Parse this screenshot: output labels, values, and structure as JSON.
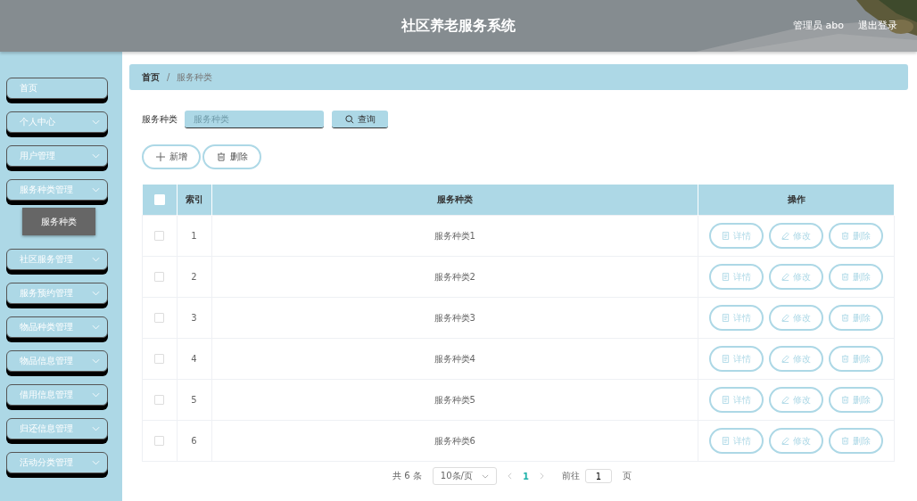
{
  "header": {
    "title": "社区养老服务系统",
    "user": "管理员 abo",
    "logout": "退出登录"
  },
  "sidebar": {
    "items": [
      {
        "label": "首页",
        "kind": "link"
      },
      {
        "label": "个人中心",
        "kind": "menu"
      },
      {
        "label": "用户管理",
        "kind": "menu"
      },
      {
        "label": "服务种类管理",
        "kind": "menu",
        "children": [
          {
            "label": "服务种类",
            "selected": true
          }
        ]
      },
      {
        "label": "社区服务管理",
        "kind": "menu"
      },
      {
        "label": "服务预约管理",
        "kind": "menu"
      },
      {
        "label": "物品种类管理",
        "kind": "menu"
      },
      {
        "label": "物品信息管理",
        "kind": "menu"
      },
      {
        "label": "借用信息管理",
        "kind": "menu"
      },
      {
        "label": "归还信息管理",
        "kind": "menu"
      },
      {
        "label": "活动分类管理",
        "kind": "menu"
      }
    ]
  },
  "breadcrumb": {
    "items": [
      "首页",
      "服务种类"
    ],
    "separator": "/"
  },
  "search": {
    "label": "服务种类",
    "placeholder": "服务种类",
    "button": "查询"
  },
  "actions": [
    "新增",
    "删除"
  ],
  "table": {
    "columns": [
      "索引",
      "服务种类",
      "操作"
    ],
    "header_checked": false,
    "rows": [
      {
        "index": "1",
        "name": "服务种类1",
        "checked": false,
        "actions": [
          "详情",
          "修改",
          "删除"
        ]
      },
      {
        "index": "2",
        "name": "服务种类2",
        "checked": false,
        "actions": [
          "详情",
          "修改",
          "删除"
        ]
      },
      {
        "index": "3",
        "name": "服务种类3",
        "checked": false,
        "actions": [
          "详情",
          "修改",
          "删除"
        ]
      },
      {
        "index": "4",
        "name": "服务种类4",
        "checked": false,
        "actions": [
          "详情",
          "修改",
          "删除"
        ]
      },
      {
        "index": "5",
        "name": "服务种类5",
        "checked": false,
        "actions": [
          "详情",
          "修改",
          "删除"
        ]
      },
      {
        "index": "6",
        "name": "服务种类6",
        "checked": false,
        "actions": [
          "详情",
          "修改",
          "删除"
        ]
      }
    ]
  },
  "pagination": {
    "total": "共 6 条",
    "page_size": "10条/页",
    "pages": [
      {
        "label": "1",
        "selected": true
      }
    ],
    "goto_label": "前往",
    "goto_value": "1",
    "goto_suffix": "页"
  }
}
